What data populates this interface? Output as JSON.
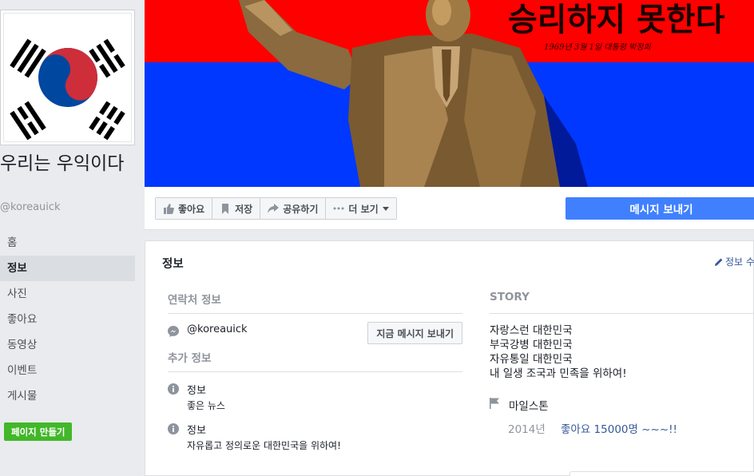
{
  "page": {
    "name": "우리는 우익이다",
    "username": "@koreauick"
  },
  "nav": {
    "items": [
      {
        "label": "홈"
      },
      {
        "label": "정보",
        "active": true
      },
      {
        "label": "사진"
      },
      {
        "label": "좋아요"
      },
      {
        "label": "동영상"
      },
      {
        "label": "이벤트"
      },
      {
        "label": "게시물"
      }
    ],
    "create_page": "페이지 만들기"
  },
  "cover": {
    "banner_text": "승리하지 못한다",
    "small_text": "1969년 3월 1일  대통령  박정희"
  },
  "actions": {
    "like": "좋아요",
    "save": "저장",
    "share": "공유하기",
    "more": "더 보기",
    "message": "메시지 보내기"
  },
  "about": {
    "title": "정보",
    "edit": "정보 수",
    "contact": {
      "title": "연락처 정보",
      "messenger": "@koreauick",
      "send_now": "지금 메시지 보내기"
    },
    "more_info": {
      "title": "추가 정보",
      "items": [
        {
          "label": "정보",
          "value": "좋은 뉴스"
        },
        {
          "label": "정보",
          "value": "자유롭고 정의로운 대한민국을 위하여!"
        }
      ]
    },
    "story": {
      "title": "STORY",
      "lines": [
        "자랑스런 대한민국",
        "부국강병 대한민국",
        "자유통일 대한민국",
        "내 일생 조국과 민족을 위하여!"
      ]
    },
    "milestone": {
      "title": "마일스톤",
      "year": "2014년",
      "text": "좋아요 15000명 ~~~!!"
    }
  },
  "colors": {
    "fb_blue": "#4080ff",
    "green": "#42b72a",
    "cover_red": "#ff0000",
    "cover_blue": "#0038ff"
  }
}
